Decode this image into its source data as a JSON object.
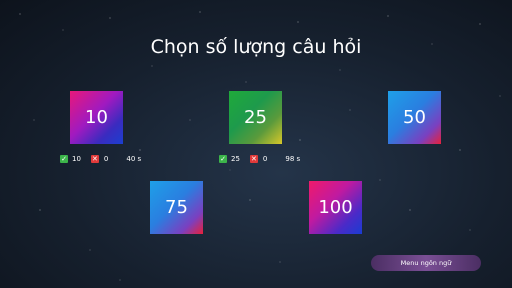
{
  "title": "Chọn số lượng câu hỏi",
  "tiles": [
    {
      "label": "10",
      "stats": {
        "correct": "10",
        "wrong": "0",
        "time": "40 s"
      }
    },
    {
      "label": "25",
      "stats": {
        "correct": "25",
        "wrong": "0",
        "time": "98 s"
      }
    },
    {
      "label": "50"
    },
    {
      "label": "75"
    },
    {
      "label": "100"
    }
  ],
  "icons": {
    "correct": "checkmark-icon",
    "wrong": "cross-icon"
  },
  "colors": {
    "correct": "#3cb44a",
    "wrong": "#e03a3a",
    "menu_button": "#6a4585"
  },
  "menu_button": "Menu ngôn ngữ"
}
